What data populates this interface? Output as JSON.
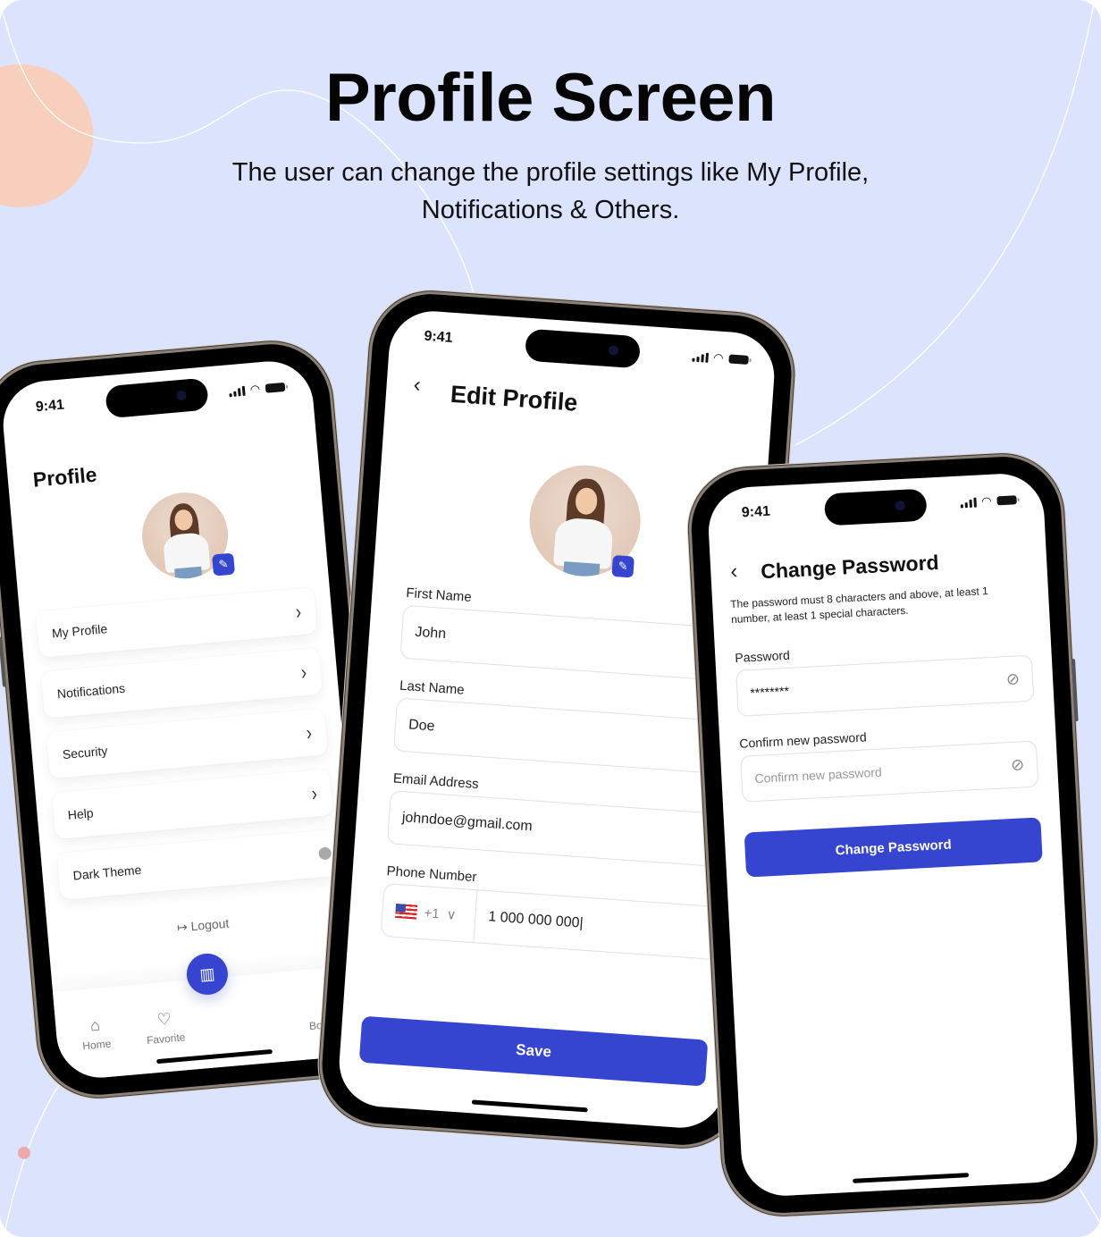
{
  "header": {
    "title": "Profile Screen",
    "subtitle_line1": "The user can change the profile settings like My Profile,",
    "subtitle_line2": "Notifications & Others."
  },
  "colors": {
    "background": "#dce3fd",
    "accent": "#3545d0",
    "peach": "#f8cfbc"
  },
  "status_bar": {
    "time": "9:41",
    "icons": [
      "signal-icon",
      "wifi-icon",
      "battery-icon"
    ]
  },
  "profile_screen": {
    "title": "Profile",
    "avatar_edit_icon": "pencil-icon",
    "menu": [
      {
        "label": "My Profile",
        "icon": "chevron-right-icon"
      },
      {
        "label": "Notifications",
        "icon": "chevron-right-icon"
      },
      {
        "label": "Security",
        "icon": "chevron-right-icon"
      },
      {
        "label": "Help",
        "icon": "chevron-right-icon"
      },
      {
        "label": "Dark Theme",
        "icon": "toggle",
        "toggle_on": false
      }
    ],
    "logout_label": "Logout",
    "tabs": [
      {
        "label": "Home",
        "icon": "home-icon"
      },
      {
        "label": "Favorite",
        "icon": "heart-icon"
      },
      {
        "label": "",
        "icon": "map-icon"
      },
      {
        "label": "Bookings",
        "icon": "calendar-icon"
      }
    ]
  },
  "edit_profile_screen": {
    "title": "Edit Profile",
    "fields": [
      {
        "label": "First Name",
        "value": "John"
      },
      {
        "label": "Last Name",
        "value": "Doe"
      },
      {
        "label": "Email Address",
        "value": "johndoe@gmail.com"
      }
    ],
    "phone": {
      "label": "Phone Number",
      "country_code": "+1",
      "value": "1 000 000 000|"
    },
    "save_label": "Save"
  },
  "change_password_screen": {
    "title": "Change Password",
    "note": "The password must 8 characters and above, at least 1 number, at least 1 special characters.",
    "password_label": "Password",
    "password_value": "********",
    "confirm_label": "Confirm new password",
    "confirm_placeholder": "Confirm new password",
    "button_label": "Change Password"
  }
}
